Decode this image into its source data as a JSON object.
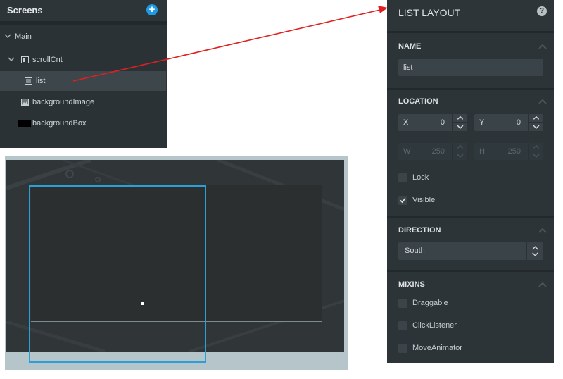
{
  "screens": {
    "title": "Screens",
    "items": [
      {
        "label": "Main",
        "icon": "chevron-down-icon"
      },
      {
        "label": "scrollCnt",
        "icon": "container-icon"
      },
      {
        "label": "list",
        "icon": "list-icon"
      },
      {
        "label": "backgroundImage",
        "icon": "image-icon"
      },
      {
        "label": "backgroundBox",
        "icon": "box-swatch-icon"
      }
    ]
  },
  "props": {
    "title": "LIST LAYOUT",
    "name": {
      "title": "NAME",
      "value": "list"
    },
    "location": {
      "title": "LOCATION",
      "x_label": "X",
      "x_value": "0",
      "y_label": "Y",
      "y_value": "0",
      "w_label": "W",
      "w_value": "250",
      "h_label": "H",
      "h_value": "250",
      "lock_label": "Lock",
      "lock_checked": false,
      "visible_label": "Visible",
      "visible_checked": true
    },
    "direction": {
      "title": "DIRECTION",
      "value": "South"
    },
    "mixins": {
      "title": "MIXINS",
      "items": [
        {
          "label": "Draggable",
          "checked": false
        },
        {
          "label": "ClickListener",
          "checked": false
        },
        {
          "label": "MoveAnimator",
          "checked": false
        }
      ]
    }
  },
  "colors": {
    "accent": "#1e9be4",
    "selection_outline": "#2a9fd8",
    "annotation_arrow": "#e02020",
    "panel_bg": "#2a3236"
  }
}
